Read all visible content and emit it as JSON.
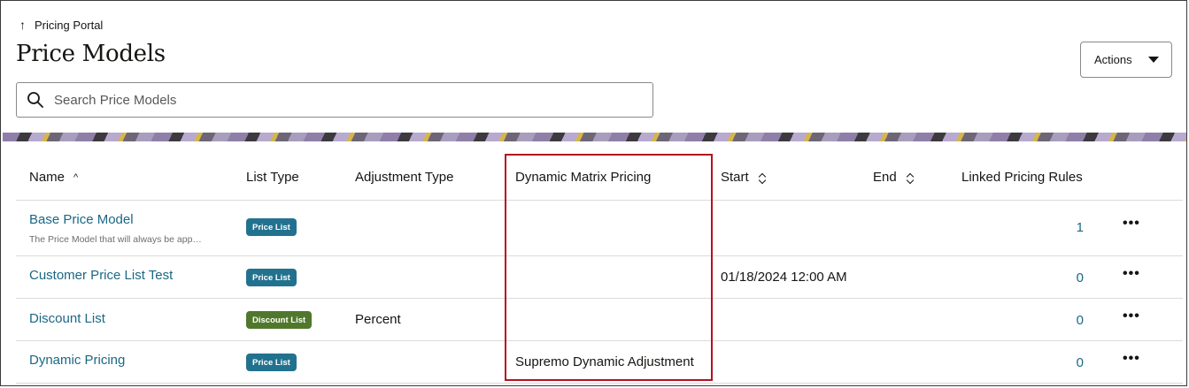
{
  "header": {
    "back_label": "Pricing Portal",
    "title": "Price Models",
    "actions_label": "Actions"
  },
  "search": {
    "placeholder": "Search Price Models",
    "value": ""
  },
  "table": {
    "columns": {
      "name": "Name",
      "list_type": "List Type",
      "adjustment_type": "Adjustment Type",
      "dynamic_matrix": "Dynamic Matrix Pricing",
      "start": "Start",
      "end": "End",
      "linked_rules": "Linked Pricing Rules"
    },
    "rows": [
      {
        "name": "Base Price Model",
        "description": "The Price Model that will always be app…",
        "list_type": "Price List",
        "adjustment_type": "",
        "dynamic_matrix": "",
        "start": "",
        "end": "",
        "linked_rules": "1"
      },
      {
        "name": "Customer Price List Test",
        "description": "",
        "list_type": "Price List",
        "adjustment_type": "",
        "dynamic_matrix": "",
        "start": "01/18/2024 12:00 AM",
        "end": "",
        "linked_rules": "0"
      },
      {
        "name": "Discount List",
        "description": "",
        "list_type": "Discount List",
        "adjustment_type": "Percent",
        "dynamic_matrix": "",
        "start": "",
        "end": "",
        "linked_rules": "0"
      },
      {
        "name": "Dynamic Pricing",
        "description": "",
        "list_type": "Price List",
        "adjustment_type": "",
        "dynamic_matrix": "Supremo Dynamic Adjustment",
        "start": "",
        "end": "",
        "linked_rules": "0"
      }
    ],
    "more_label": "•••"
  },
  "colors": {
    "link": "#1b6784",
    "price_badge": "#22728f",
    "discount_badge": "#50782d",
    "highlight": "#b4121e"
  }
}
